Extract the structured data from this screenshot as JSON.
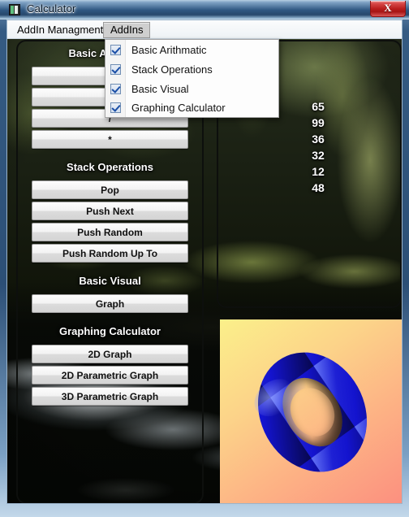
{
  "window": {
    "title": "Calculator",
    "icon": "app-icon",
    "close_label": "X"
  },
  "menubar": {
    "items": [
      {
        "label": "AddIn Managment",
        "active": false
      },
      {
        "label": "AddIns",
        "active": true
      }
    ]
  },
  "dropdown": {
    "open": true,
    "items": [
      {
        "label": "Basic Arithmatic",
        "checked": true
      },
      {
        "label": "Stack Operations",
        "checked": true
      },
      {
        "label": "Basic Visual",
        "checked": true
      },
      {
        "label": "Graphing Calculator",
        "checked": true
      }
    ]
  },
  "sections": [
    {
      "heading": "Basic Arithmatic",
      "buttons": [
        {
          "label": "+"
        },
        {
          "label": "-"
        },
        {
          "label": "/"
        },
        {
          "label": "*"
        }
      ]
    },
    {
      "heading": "Stack Operations",
      "buttons": [
        {
          "label": "Pop"
        },
        {
          "label": "Push Next"
        },
        {
          "label": "Push Random"
        },
        {
          "label": "Push Random Up To"
        }
      ]
    },
    {
      "heading": "Basic Visual",
      "buttons": [
        {
          "label": "Graph"
        }
      ]
    },
    {
      "heading": "Graphing Calculator",
      "buttons": [
        {
          "label": "2D Graph"
        },
        {
          "label": "2D Parametric Graph"
        },
        {
          "label": "3D Parametric Graph"
        }
      ]
    }
  ],
  "stack_display": {
    "values": [
      "65",
      "99",
      "36",
      "32",
      "12",
      "48"
    ]
  },
  "render_panel": {
    "name": "3d-torus-render",
    "shape_color": "#1414cf",
    "background_from": "#fbf08a",
    "background_to": "#fc8f7f"
  },
  "colors": {
    "titlebar_accent": "#2f5781",
    "close_button": "#bb1f1f",
    "checkbox_check": "#1b4fa6"
  }
}
